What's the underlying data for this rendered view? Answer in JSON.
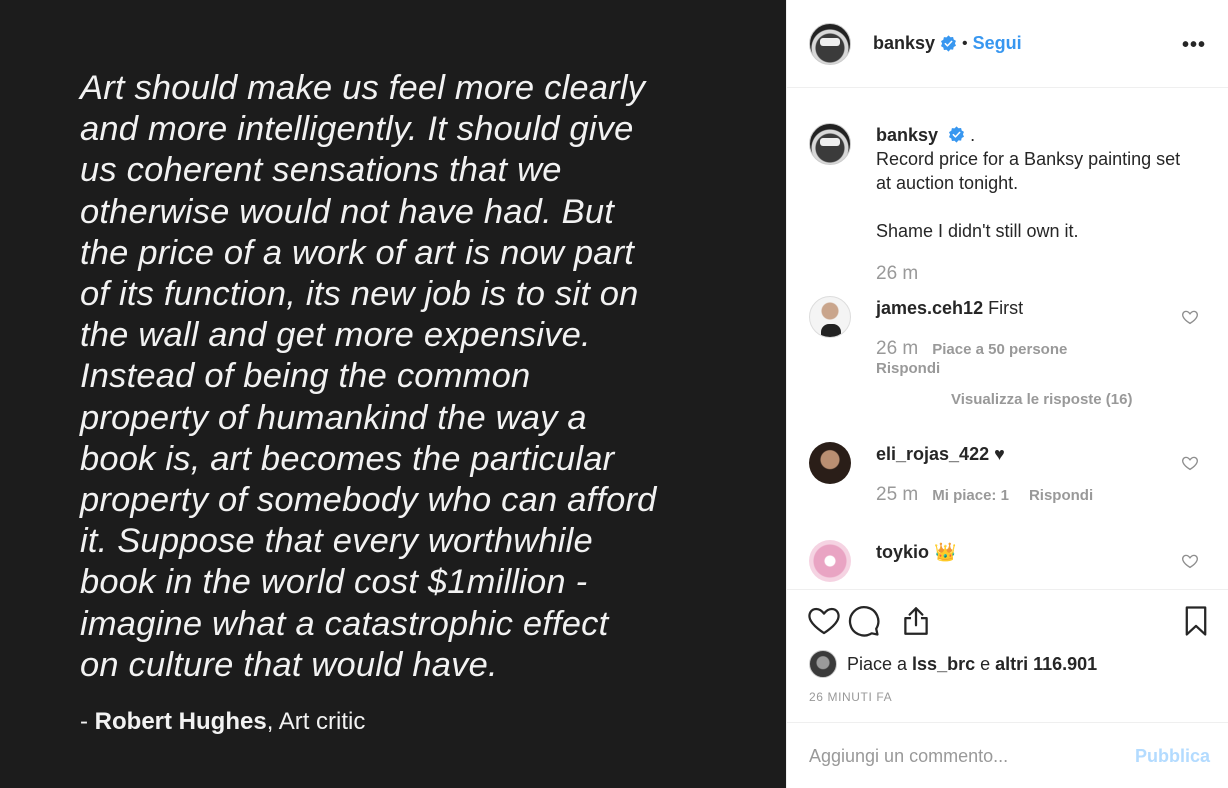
{
  "media": {
    "quote_lines": [
      "Art should make us feel more clearly",
      "and more intelligently. It should give",
      "us coherent sensations that we",
      "otherwise would not have had. But",
      "the price of a work of art is now part",
      "of its function, its new job is to sit on",
      "the wall and get more expensive.",
      "Instead of being the common",
      "property of humankind the way a",
      "book is, art becomes the particular",
      "property of somebody who can afford",
      "it. Suppose that every worthwhile",
      "book in the world cost $1million -",
      "imagine what a catastrophic effect",
      "on culture that would have."
    ],
    "attribution_prefix": "- ",
    "attribution_name": "Robert Hughes",
    "attribution_role": ", Art critic"
  },
  "header": {
    "username": "banksy",
    "separator": "•",
    "follow_label": "Segui",
    "more_label": "•••"
  },
  "caption": {
    "username": "banksy",
    "text_line1": ".",
    "text_line2": "Record price for a Banksy painting set at auction tonight.",
    "text_line3": "Shame I didn't still own it.",
    "time": "26 m"
  },
  "comments": [
    {
      "username": "james.ceh12",
      "text": "First",
      "time": "26 m",
      "likes": "Piace a 50 persone",
      "reply": "Rispondi",
      "view_replies": "Visualizza le risposte (16)"
    },
    {
      "username": "eli_rojas_422",
      "text": "♥",
      "time": "25 m",
      "likes": "Mi piace: 1",
      "reply": "Rispondi"
    },
    {
      "username": "toykio",
      "text": "👑"
    }
  ],
  "actions": {
    "liked_by_prefix": "Piace a ",
    "liked_by_user": "lss_brc",
    "liked_by_mid": " e ",
    "liked_by_others": "altri 116.901",
    "time_ago": "26 MINUTI FA"
  },
  "add_comment": {
    "placeholder": "Aggiungi un commento...",
    "publish_label": "Pubblica"
  },
  "colors": {
    "accent": "#3897f0",
    "publish_disabled": "#b3dbff",
    "media_bg": "#1c1c1c",
    "muted": "#999999"
  },
  "icons": [
    "verified-badge-icon",
    "more-options-icon",
    "heart-icon",
    "comment-icon",
    "share-icon",
    "bookmark-icon"
  ]
}
